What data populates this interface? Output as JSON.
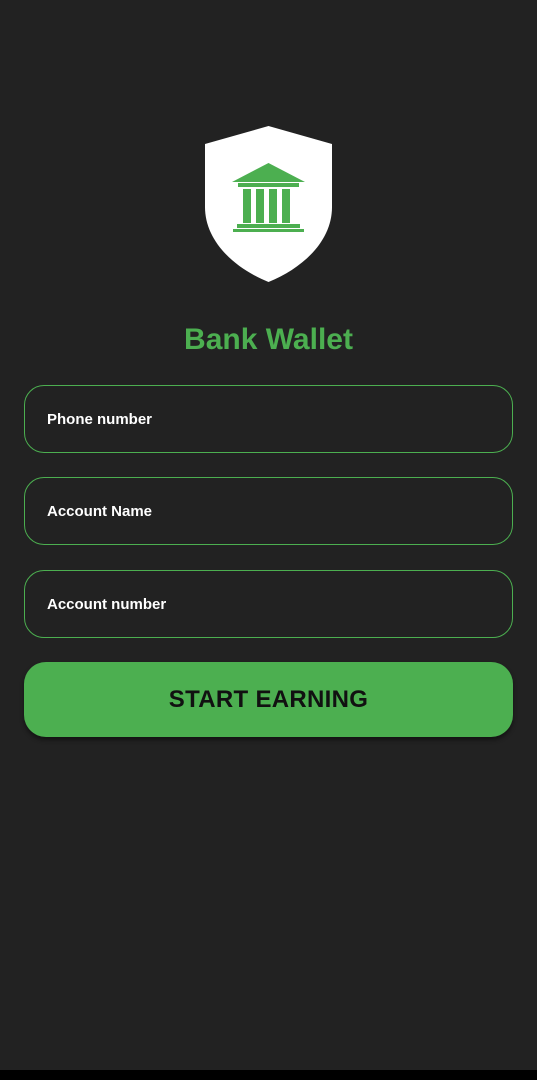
{
  "app": {
    "title": "Bank Wallet",
    "logo_icon": "bank-shield-icon"
  },
  "form": {
    "phone_placeholder": "Phone number",
    "account_name_placeholder": "Account Name",
    "account_number_placeholder": "Account number",
    "submit_label": "START EARNING"
  },
  "colors": {
    "background": "#222222",
    "accent": "#4caf50",
    "shield": "#ffffff"
  }
}
